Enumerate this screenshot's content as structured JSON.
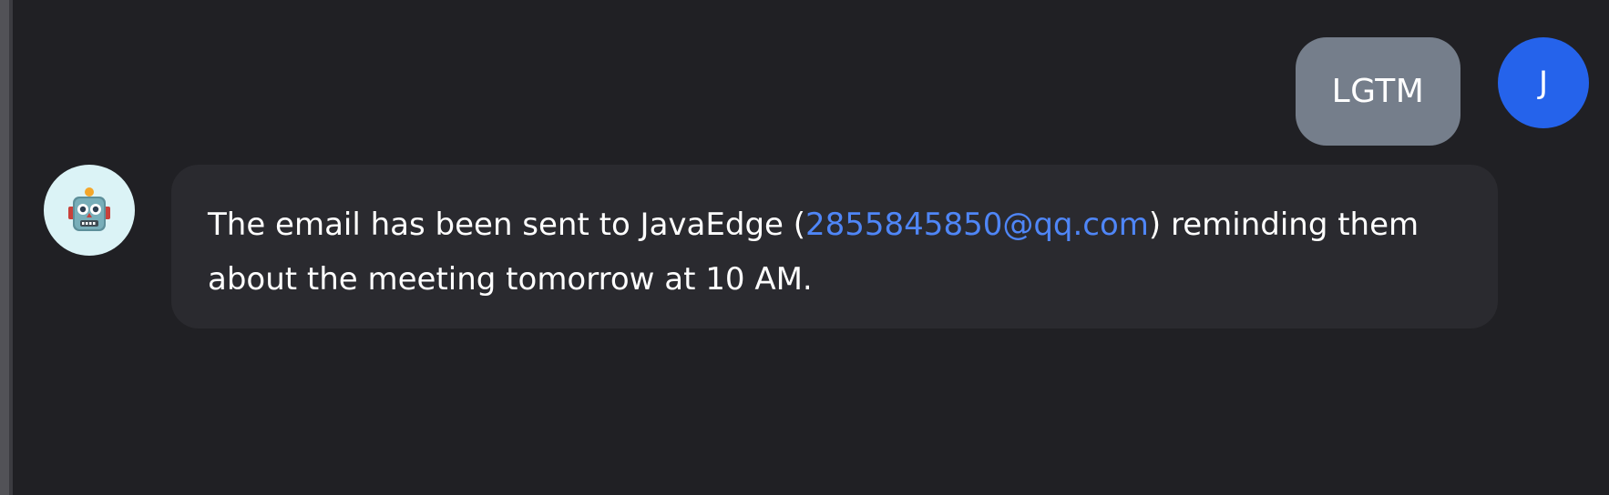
{
  "conversation": {
    "user_message": {
      "text": "LGTM",
      "avatar_initial": "J",
      "avatar_color": "#2563eb",
      "bubble_color": "#757e8b"
    },
    "assistant_message": {
      "avatar_icon": "robot-icon",
      "avatar_bg": "#dbf3f6",
      "text_before": "The email has been sent to JavaEdge (",
      "email": "2855845850@qq.com",
      "text_after": ") reminding them about the meeting tomorrow at 10 AM.",
      "link_color": "#4f86f7",
      "bubble_color": "#2a2a2f"
    },
    "background_color": "#202024"
  }
}
